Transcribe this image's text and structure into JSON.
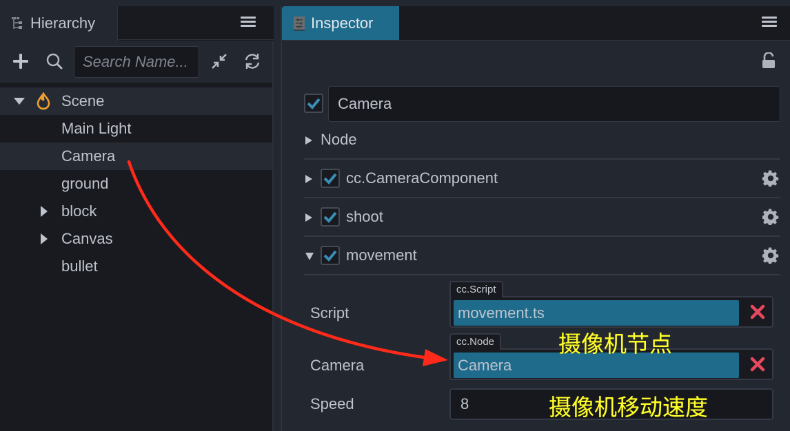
{
  "hierarchy": {
    "tab_label": "Hierarchy",
    "search_placeholder": "Search Name...",
    "toolbar_icons": [
      "plus-icon",
      "search-icon",
      "collapse-icon",
      "refresh-icon"
    ],
    "tree": [
      {
        "label": "Scene",
        "expanded": true,
        "icon": "scene-flame-icon",
        "highlight": true
      },
      {
        "label": "Main Light"
      },
      {
        "label": "Camera",
        "selected": true
      },
      {
        "label": "ground"
      },
      {
        "label": "block",
        "collapsed": true
      },
      {
        "label": "Canvas",
        "collapsed": true
      },
      {
        "label": "bullet"
      }
    ]
  },
  "inspector": {
    "tab_label": "Inspector",
    "node_enabled": true,
    "node_name": "Camera",
    "sections": [
      {
        "label": "Node",
        "expanded": false,
        "has_checkbox": false
      },
      {
        "label": "cc.CameraComponent",
        "expanded": false,
        "checked": true
      },
      {
        "label": "shoot",
        "expanded": false,
        "checked": true
      },
      {
        "label": "movement",
        "expanded": true,
        "checked": true
      }
    ],
    "properties": {
      "script": {
        "label": "Script",
        "type_tag": "cc.Script",
        "value": "movement.ts",
        "locked": true
      },
      "camera": {
        "label": "Camera",
        "type_tag": "cc.Node",
        "value": "Camera"
      },
      "speed": {
        "label": "Speed",
        "value": "8"
      }
    }
  },
  "annotations": {
    "camera_node": "摄像机节点",
    "camera_speed": "摄像机移动速度"
  },
  "colors": {
    "accent": "#1f6b8b",
    "check": "#3a8db5",
    "clear": "#e8485f",
    "annotation": "#ffff2a",
    "arrow": "#ff2a1a",
    "scene_icon": "#f0a030"
  }
}
